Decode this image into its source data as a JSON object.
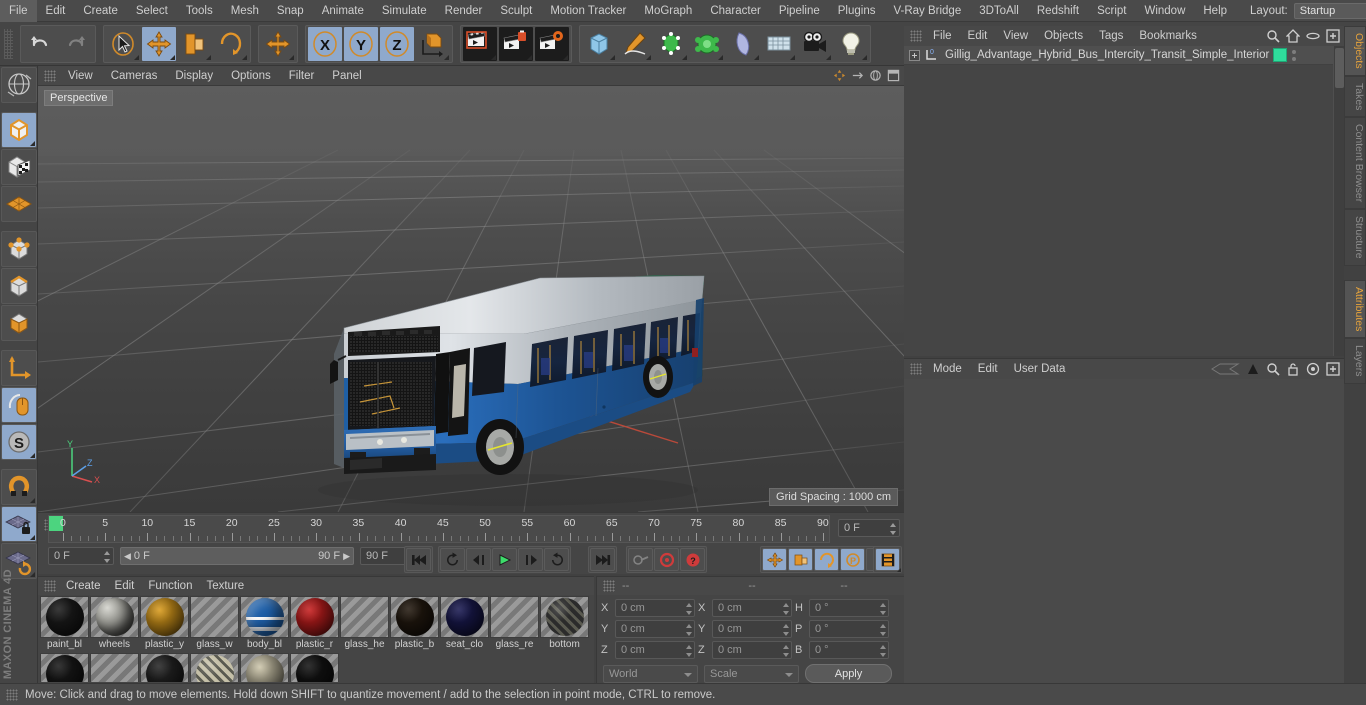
{
  "app": {
    "brand": "MAXON CINEMA 4D"
  },
  "menubar": {
    "items": [
      "File",
      "Edit",
      "Create",
      "Select",
      "Tools",
      "Mesh",
      "Snap",
      "Animate",
      "Simulate",
      "Render",
      "Sculpt",
      "Motion Tracker",
      "MoGraph",
      "Character",
      "Pipeline",
      "Plugins",
      "V-Ray Bridge",
      "3DToAll",
      "Redshift",
      "Script",
      "Window",
      "Help"
    ],
    "layout_label": "Layout:",
    "layout_value": "Startup",
    "search_icon": "magnifier-icon"
  },
  "toolbar": {
    "groups": [
      {
        "name": "history",
        "buttons": [
          {
            "name": "undo-button",
            "icon": "undo-arrow-icon",
            "state": "normal"
          },
          {
            "name": "redo-button",
            "icon": "redo-arrow-icon",
            "state": "disabled"
          }
        ]
      },
      {
        "name": "transform-tools",
        "buttons": [
          {
            "name": "live-selection-tool",
            "icon": "cursor-selection-icon",
            "state": "normal"
          },
          {
            "name": "move-tool",
            "icon": "move-arrows-icon",
            "state": "active"
          },
          {
            "name": "scale-tool",
            "icon": "scale-box-icon",
            "state": "normal"
          },
          {
            "name": "rotate-tool",
            "icon": "rotate-ring-icon",
            "state": "normal"
          }
        ]
      },
      {
        "name": "free-move",
        "buttons": [
          {
            "name": "free-move-tool",
            "icon": "move-arrows-icon",
            "state": "normal"
          }
        ]
      },
      {
        "name": "axis-locks",
        "buttons": [
          {
            "name": "lock-x-axis",
            "icon": "axis-x-icon",
            "label": "X",
            "state": "active"
          },
          {
            "name": "lock-y-axis",
            "icon": "axis-y-icon",
            "label": "Y",
            "state": "active"
          },
          {
            "name": "lock-z-axis",
            "icon": "axis-z-icon",
            "label": "Z",
            "state": "active"
          },
          {
            "name": "world-object-coord-toggle",
            "icon": "world-axis-icon",
            "state": "normal"
          }
        ]
      },
      {
        "name": "render-tools",
        "buttons": [
          {
            "name": "render-view-button",
            "icon": "clapperboard-render-icon",
            "state": "dark"
          },
          {
            "name": "render-region-button",
            "icon": "clapperboard-region-icon",
            "state": "dark"
          },
          {
            "name": "render-settings-button",
            "icon": "clapperboard-settings-icon",
            "state": "dark"
          }
        ]
      },
      {
        "name": "create-objects",
        "buttons": [
          {
            "name": "add-primitive-cube",
            "icon": "cube-primitive-icon",
            "state": "normal"
          },
          {
            "name": "add-spline-pen",
            "icon": "pen-spline-icon",
            "state": "normal"
          },
          {
            "name": "add-generator",
            "icon": "green-generator-icon",
            "state": "normal"
          },
          {
            "name": "add-deformer",
            "icon": "green-deformer-icon",
            "state": "normal"
          },
          {
            "name": "add-environment",
            "icon": "sky-environment-icon",
            "state": "normal"
          },
          {
            "name": "add-floor",
            "icon": "floor-grid-icon",
            "state": "normal"
          },
          {
            "name": "add-camera",
            "icon": "camera-icon",
            "state": "normal"
          },
          {
            "name": "add-light",
            "icon": "lightbulb-icon",
            "state": "normal"
          }
        ]
      }
    ]
  },
  "left_toolbar": {
    "buttons": [
      {
        "name": "undo-view-button",
        "icon": "globe-wire-icon",
        "state": "normal"
      },
      {
        "name": "model-mode-button",
        "icon": "orange-cube-icon",
        "state": "active"
      },
      {
        "name": "texture-mode-button",
        "icon": "checker-cube-icon",
        "state": "normal"
      },
      {
        "name": "workplane-mode-button",
        "icon": "orange-plane-icon",
        "state": "normal"
      },
      {
        "name": "points-mode-button",
        "icon": "cube-points-icon",
        "state": "normal"
      },
      {
        "name": "edges-mode-button",
        "icon": "cube-edges-icon",
        "state": "normal"
      },
      {
        "name": "polygons-mode-button",
        "icon": "cube-polygons-icon",
        "state": "normal"
      },
      {
        "name": "object-axis-mode-button",
        "icon": "axis-corner-icon",
        "state": "normal"
      },
      {
        "name": "enable-axis-modification",
        "icon": "mouse-axis-icon",
        "state": "active"
      },
      {
        "name": "soft-selection-button",
        "icon": "s-circle-icon",
        "state": "active"
      },
      {
        "name": "snap-magnet-button",
        "icon": "magnet-icon",
        "state": "normal"
      },
      {
        "name": "lock-workplane-button",
        "icon": "grid-lock-icon",
        "state": "active"
      },
      {
        "name": "planar-workplane-button",
        "icon": "grid-rotate-icon",
        "state": "normal"
      }
    ]
  },
  "viewport": {
    "menu": [
      "View",
      "Cameras",
      "Display",
      "Options",
      "Filter",
      "Panel"
    ],
    "view_label": "Perspective",
    "grid_spacing": "Grid Spacing : 1000 cm",
    "axis_labels": {
      "x": "X",
      "y": "Y",
      "z": "Z"
    },
    "nav_icons": [
      "pan-icon",
      "zoom-icon",
      "rotate-icon",
      "maximize-icon"
    ]
  },
  "timeline": {
    "ticks": [
      0,
      5,
      10,
      15,
      20,
      25,
      30,
      35,
      40,
      45,
      50,
      55,
      60,
      65,
      70,
      75,
      80,
      85,
      90
    ],
    "current_frame_field": "0 F",
    "current_frame_field2": "0 F",
    "range_start": "0 F",
    "range_end": "90 F",
    "end_frame_field": "90 F",
    "playhead_frame": 0,
    "transport": [
      {
        "name": "go-to-start-button",
        "icon": "skip-start-icon"
      },
      {
        "name": "go-to-previous-key-button",
        "icon": "prev-key-icon"
      },
      {
        "name": "step-back-button",
        "icon": "step-back-icon"
      },
      {
        "name": "play-button",
        "icon": "play-icon"
      },
      {
        "name": "step-forward-button",
        "icon": "step-forward-icon"
      },
      {
        "name": "go-to-next-key-button",
        "icon": "next-key-icon"
      },
      {
        "name": "go-to-end-button",
        "icon": "skip-end-icon"
      }
    ],
    "record_tools": [
      {
        "name": "record-active-objects-button",
        "icon": "key-record-icon",
        "state": "disabled"
      },
      {
        "name": "autokeying-button",
        "icon": "red-circle-icon",
        "state": "normal"
      },
      {
        "name": "keyframe-selection-button",
        "icon": "red-question-icon",
        "state": "normal"
      }
    ],
    "key_toggles": [
      {
        "name": "record-position-toggle",
        "icon": "move-arrows-icon",
        "state": "active"
      },
      {
        "name": "record-scale-toggle",
        "icon": "scale-box-icon",
        "state": "active"
      },
      {
        "name": "record-rotation-toggle",
        "icon": "rotate-ring-icon",
        "state": "active"
      },
      {
        "name": "record-parameter-toggle",
        "icon": "p-circle-icon",
        "state": "active"
      },
      {
        "name": "record-pla-toggle",
        "icon": "point-dots-icon",
        "state": "normal"
      }
    ],
    "extra": [
      {
        "name": "timeline-keyframe-button",
        "icon": "filmstrip-icon",
        "state": "active"
      }
    ]
  },
  "materials": {
    "menu": [
      "Create",
      "Edit",
      "Function",
      "Texture"
    ],
    "items": [
      {
        "name": "paint_bl",
        "color": "#1d1d1d",
        "kind": "solid"
      },
      {
        "name": "wheels",
        "color": "#8a8a86",
        "kind": "tire"
      },
      {
        "name": "plastic_y",
        "color": "#d99b1c",
        "kind": "solid"
      },
      {
        "name": "glass_w",
        "color": "",
        "kind": "empty"
      },
      {
        "name": "body_bl",
        "color": "#1e5fa8",
        "kind": "stripe"
      },
      {
        "name": "plastic_r",
        "color": "#c71f1f",
        "kind": "solid"
      },
      {
        "name": "glass_he",
        "color": "",
        "kind": "empty"
      },
      {
        "name": "plastic_b",
        "color": "#241a10",
        "kind": "solid"
      },
      {
        "name": "seat_clo",
        "color": "#1a1a52",
        "kind": "solid"
      },
      {
        "name": "glass_re",
        "color": "",
        "kind": "empty"
      },
      {
        "name": "bottom",
        "color": "#2b2b2b",
        "kind": "tex"
      },
      {
        "name": "",
        "color": "#1a1a1a",
        "kind": "solid"
      },
      {
        "name": "",
        "color": "",
        "kind": "empty"
      },
      {
        "name": "",
        "color": "#262626",
        "kind": "solid"
      },
      {
        "name": "",
        "color": "#c5c0a8",
        "kind": "tex"
      },
      {
        "name": "",
        "color": "#cdc6ab",
        "kind": "solid"
      },
      {
        "name": "",
        "color": "#141414",
        "kind": "solid"
      }
    ]
  },
  "coordinates": {
    "col_headers": [
      "--",
      "--",
      "--"
    ],
    "rows": [
      {
        "pos_label": "X",
        "pos_value": "0 cm",
        "size_label": "X",
        "size_value": "0 cm",
        "rot_label": "H",
        "rot_value": "0 °"
      },
      {
        "pos_label": "Y",
        "pos_value": "0 cm",
        "size_label": "Y",
        "size_value": "0 cm",
        "rot_label": "P",
        "rot_value": "0 °"
      },
      {
        "pos_label": "Z",
        "pos_value": "0 cm",
        "size_label": "Z",
        "size_value": "0 cm",
        "rot_label": "B",
        "rot_value": "0 °"
      }
    ],
    "system_dropdown": "World",
    "mode_dropdown": "Scale",
    "apply_label": "Apply"
  },
  "object_manager": {
    "menu": [
      "File",
      "Edit",
      "View",
      "Objects",
      "Tags",
      "Bookmarks"
    ],
    "header_icons": [
      "search-icon",
      "home-icon",
      "filter-icon",
      "add-layer-icon"
    ],
    "objects": [
      {
        "name": "Gillig_Advantage_Hybrid_Bus_Intercity_Transit_Simple_Interior",
        "layer_badge": "0",
        "material_tag_color": "#2fdd9c"
      }
    ]
  },
  "attributes": {
    "menu": [
      "Mode",
      "Edit",
      "User Data"
    ],
    "header_icons": [
      "history-arrow-icon",
      "pin-up-icon",
      "search-icon",
      "lock-icon",
      "target-icon",
      "add-icon"
    ],
    "content": ""
  },
  "right_tabs": {
    "top": [
      {
        "label": "Objects",
        "selected": true
      },
      {
        "label": "Takes",
        "selected": false
      },
      {
        "label": "Content Browser",
        "selected": false
      },
      {
        "label": "Structure",
        "selected": false
      }
    ],
    "bottom": [
      {
        "label": "Attributes",
        "selected": true
      },
      {
        "label": "Layers",
        "selected": false
      }
    ]
  },
  "statusbar": {
    "message": "Move: Click and drag to move elements. Hold down SHIFT to quantize movement / add to the selection in point mode, CTRL to remove."
  },
  "colors": {
    "accent_orange": "#e6a33c",
    "active_blue": "#8fa9cc",
    "panel_bg": "#454545",
    "menu_bg": "#4a4a4a",
    "material_green": "#2fdd9c",
    "playhead_green": "#4cd47f"
  }
}
